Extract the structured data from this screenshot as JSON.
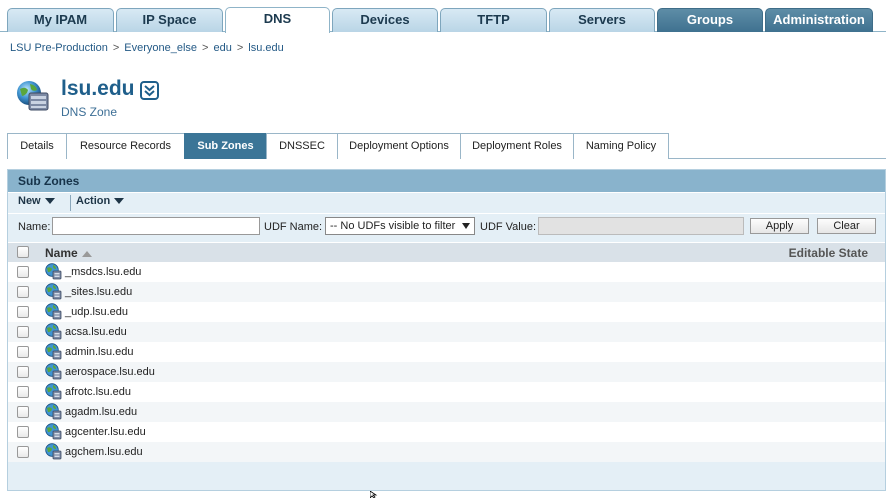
{
  "top_tabs": [
    "My IPAM",
    "IP Space",
    "DNS",
    "Devices",
    "TFTP",
    "Servers",
    "Groups",
    "Administration"
  ],
  "breadcrumb": [
    "LSU Pre-Production",
    "Everyone_else",
    "edu",
    "lsu.edu"
  ],
  "zone": {
    "title": "lsu.edu",
    "subtitle": "DNS Zone"
  },
  "sub_tabs": [
    "Details",
    "Resource Records",
    "Sub Zones",
    "DNSSEC",
    "Deployment Options",
    "Deployment Roles",
    "Naming Policy"
  ],
  "panel": {
    "title": "Sub Zones",
    "toolbar": {
      "new_label": "New",
      "action_label": "Action"
    },
    "filter": {
      "name_label": "Name:",
      "name_value": "",
      "udf_name_label": "UDF Name:",
      "udf_name_selected": "-- No UDFs visible to filter",
      "udf_value_label": "UDF Value:",
      "apply_label": "Apply",
      "clear_label": "Clear"
    },
    "columns": {
      "name": "Name",
      "state": "Editable State"
    },
    "rows": [
      "_msdcs.lsu.edu",
      "_sites.lsu.edu",
      "_udp.lsu.edu",
      "acsa.lsu.edu",
      "admin.lsu.edu",
      "aerospace.lsu.edu",
      "afrotc.lsu.edu",
      "agadm.lsu.edu",
      "agcenter.lsu.edu",
      "agchem.lsu.edu"
    ]
  },
  "colors": {
    "accent": "#3b7597",
    "title": "#1f5f8b",
    "panel_header": "#89b3cc"
  }
}
